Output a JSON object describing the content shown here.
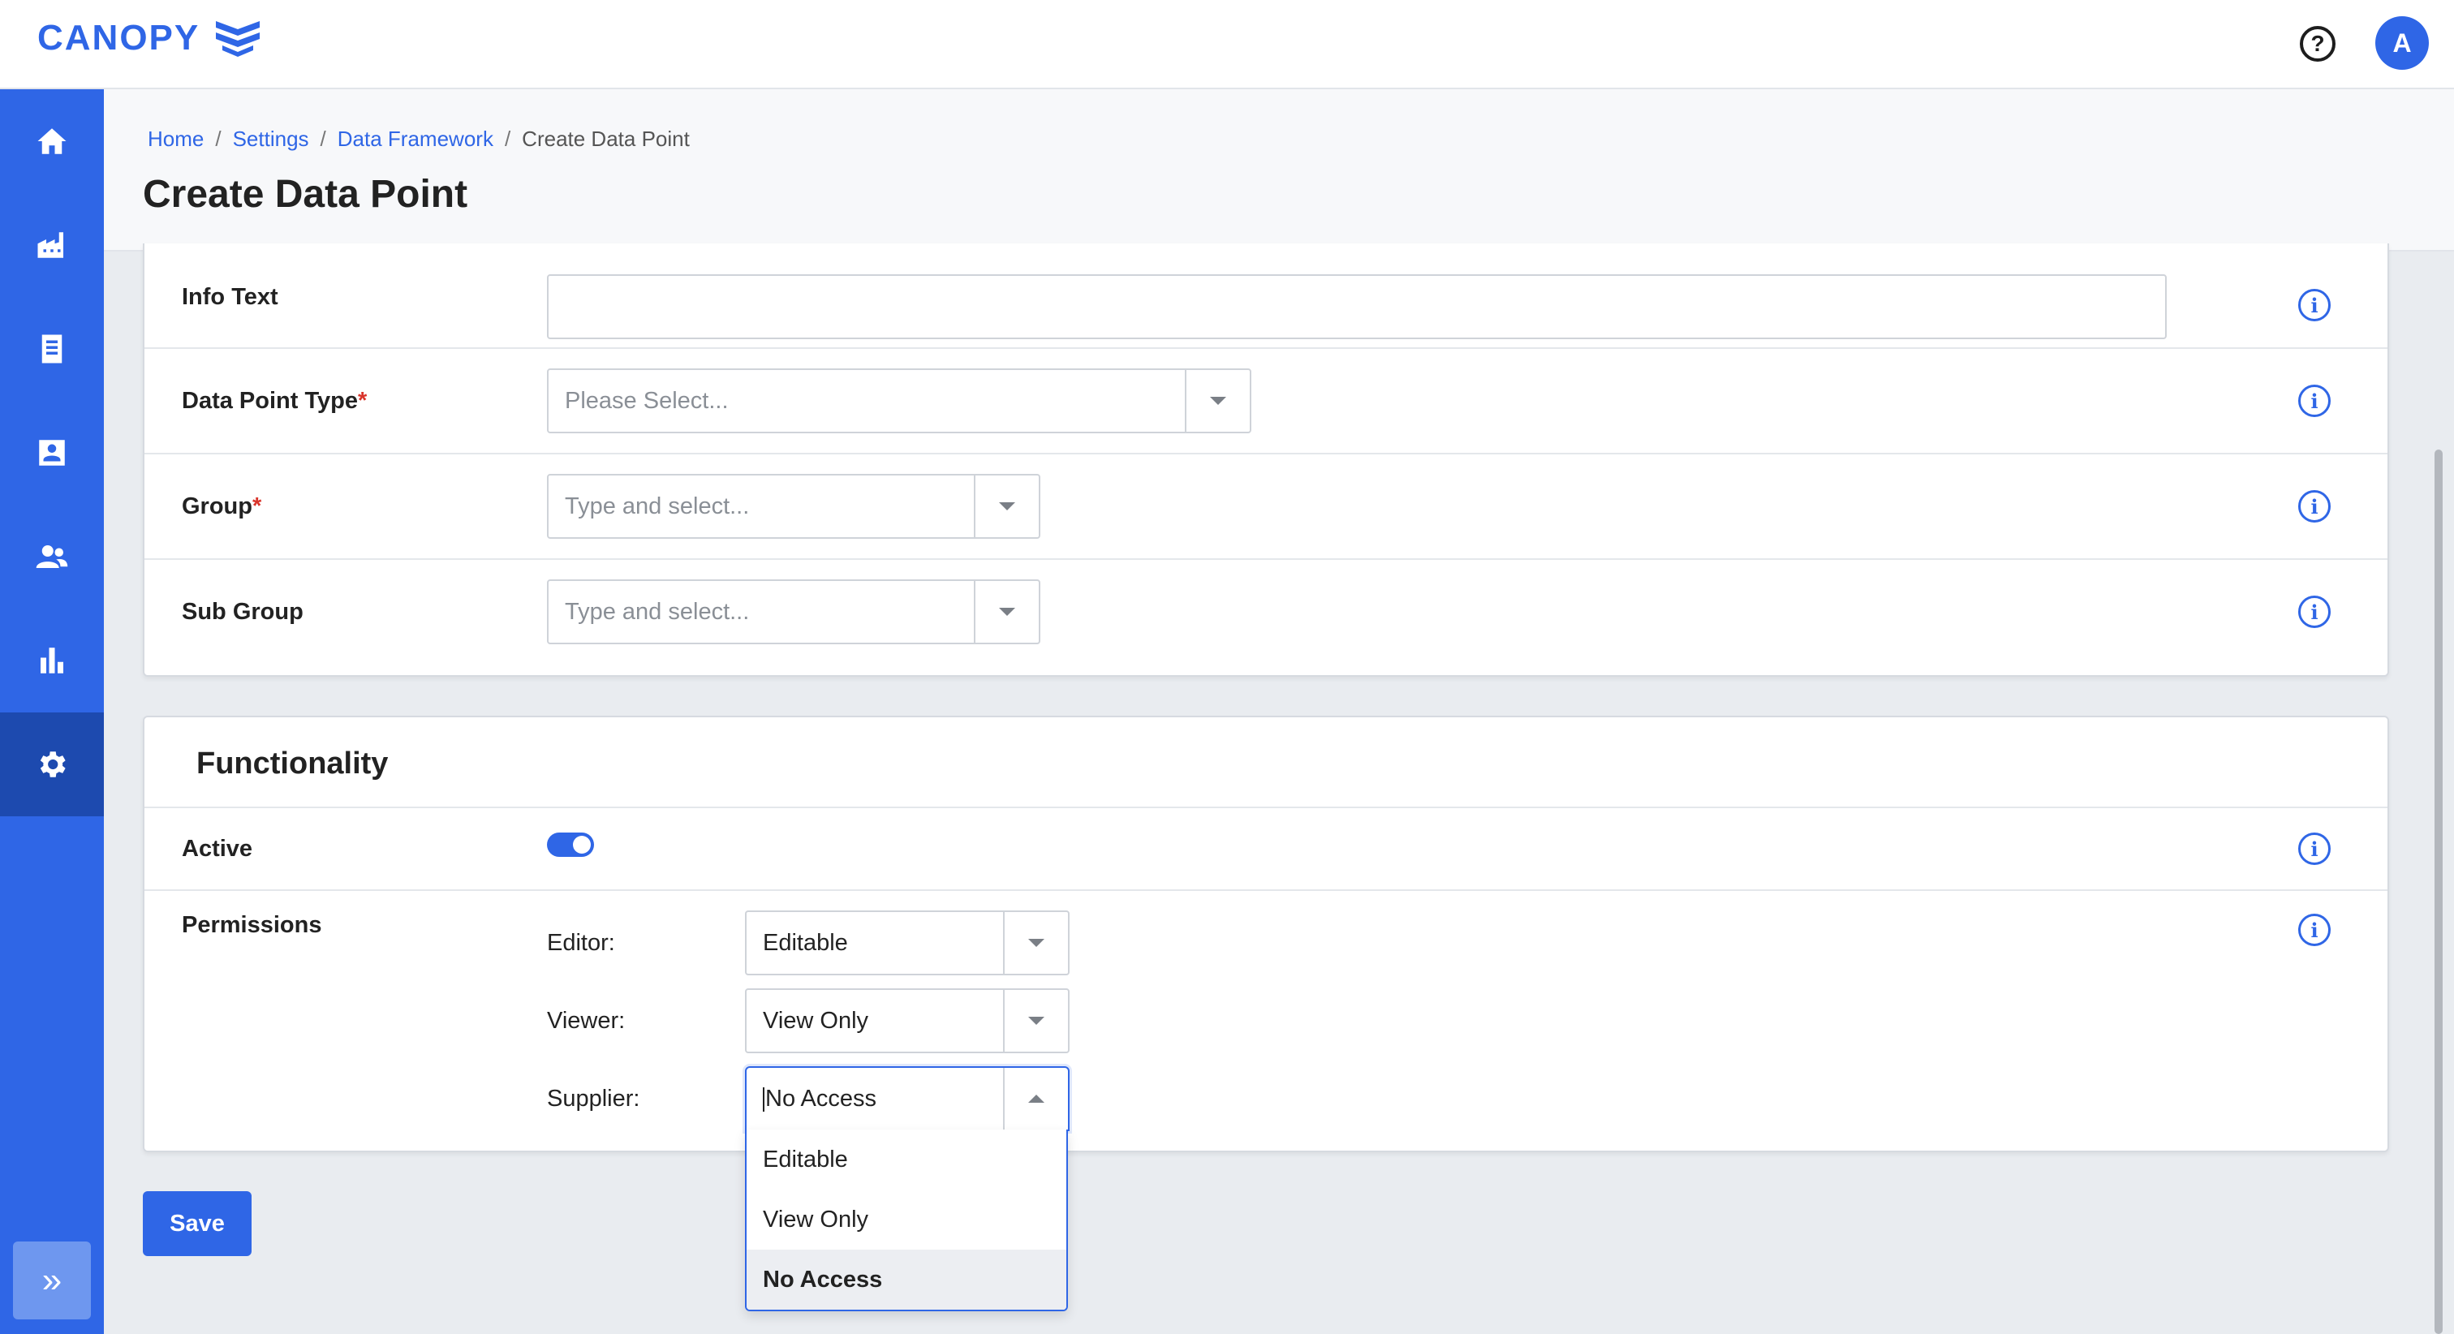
{
  "app": {
    "name": "CANOPY",
    "avatar_initial": "A"
  },
  "header": {
    "help_icon": "question-circle-icon"
  },
  "sidebar": {
    "items": [
      {
        "name": "home",
        "icon": "home-icon"
      },
      {
        "name": "factory",
        "icon": "factory-icon"
      },
      {
        "name": "documents",
        "icon": "document-icon"
      },
      {
        "name": "contacts",
        "icon": "contact-card-icon"
      },
      {
        "name": "users",
        "icon": "users-icon"
      },
      {
        "name": "reports",
        "icon": "bar-chart-icon"
      },
      {
        "name": "settings",
        "icon": "gear-icon",
        "active": true
      }
    ],
    "expand_label": "»"
  },
  "breadcrumb": {
    "items": [
      "Home",
      "Settings",
      "Data Framework"
    ],
    "current": "Create Data Point",
    "separator": "/"
  },
  "page": {
    "title": "Create Data Point"
  },
  "details": {
    "info_text": {
      "label": "Info Text",
      "value": ""
    },
    "data_point_type": {
      "label": "Data Point Type",
      "required_mark": "*",
      "placeholder": "Please Select..."
    },
    "group": {
      "label": "Group",
      "required_mark": "*",
      "placeholder": "Type and select..."
    },
    "sub_group": {
      "label": "Sub Group",
      "placeholder": "Type and select..."
    }
  },
  "functionality": {
    "title": "Functionality",
    "active": {
      "label": "Active",
      "enabled": true
    },
    "permissions": {
      "label": "Permissions",
      "editor": {
        "label": "Editor:",
        "value": "Editable"
      },
      "viewer": {
        "label": "Viewer:",
        "value": "View Only"
      },
      "supplier": {
        "label": "Supplier:",
        "value": "No Access"
      }
    }
  },
  "dropdown": {
    "options": [
      "Editable",
      "View Only",
      "No Access"
    ],
    "selected": "No Access"
  },
  "actions": {
    "save_label": "Save"
  },
  "colors": {
    "brand": "#2f66e6",
    "sidebar_active": "#1d4aaf",
    "required": "#d9342b"
  }
}
